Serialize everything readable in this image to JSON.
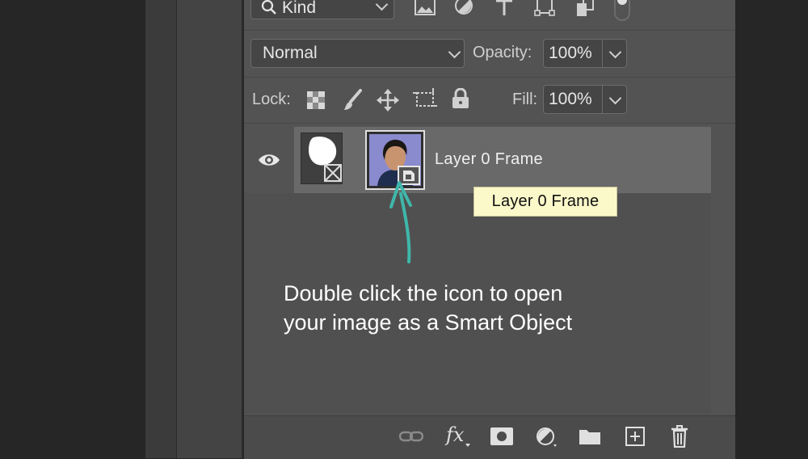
{
  "filter": {
    "kind_label": "Kind"
  },
  "blend": {
    "mode": "Normal",
    "opacity_label": "Opacity:",
    "opacity_value": "100%"
  },
  "lock": {
    "label": "Lock:",
    "fill_label": "Fill:",
    "fill_value": "100%"
  },
  "layer": {
    "name": "Layer 0 Frame",
    "tooltip": "Layer 0 Frame"
  },
  "annotation": {
    "line1": "Double click the icon to open",
    "line2": "your image as a Smart Object",
    "arrow_color": "#3fb7aa"
  },
  "footer": {
    "icons": [
      "link-icon",
      "fx-icon",
      "mask-icon",
      "adjustment-icon",
      "folder-icon",
      "new-layer-icon",
      "trash-icon"
    ],
    "fx_label": "fx"
  },
  "colors": {
    "panel": "#535353",
    "tooltip_bg": "#fbf8c9",
    "accent": "#3fb7aa"
  }
}
